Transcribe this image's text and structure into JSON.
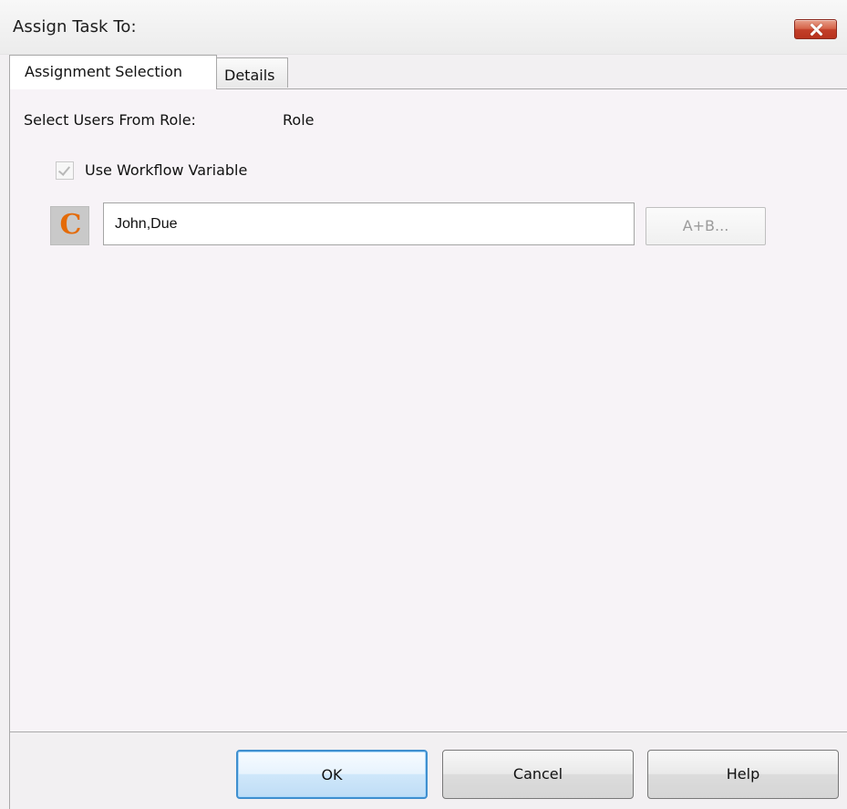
{
  "window": {
    "title": "Assign Task To:",
    "close_icon": "close-icon"
  },
  "tabs": [
    {
      "label": "Assignment Selection",
      "active": true
    },
    {
      "label": "Details",
      "active": false
    }
  ],
  "assignment": {
    "select_users_label": "Select Users From Role:",
    "role_value": "Role",
    "checkbox": {
      "label": "Use Workflow Variable",
      "checked": true,
      "disabled": true
    },
    "input": {
      "value": "John,Due",
      "placeholder": ""
    },
    "constant_icon_text": "C",
    "formula_button_label": "A+B..."
  },
  "buttons": {
    "ok": "OK",
    "cancel": "Cancel",
    "help": "Help"
  },
  "colors": {
    "title_close_accent": "#c23f29",
    "constant_icon": "#e46b08",
    "ok_focus_border": "#3f8fcf",
    "panel_background": "#f7f3f7"
  }
}
